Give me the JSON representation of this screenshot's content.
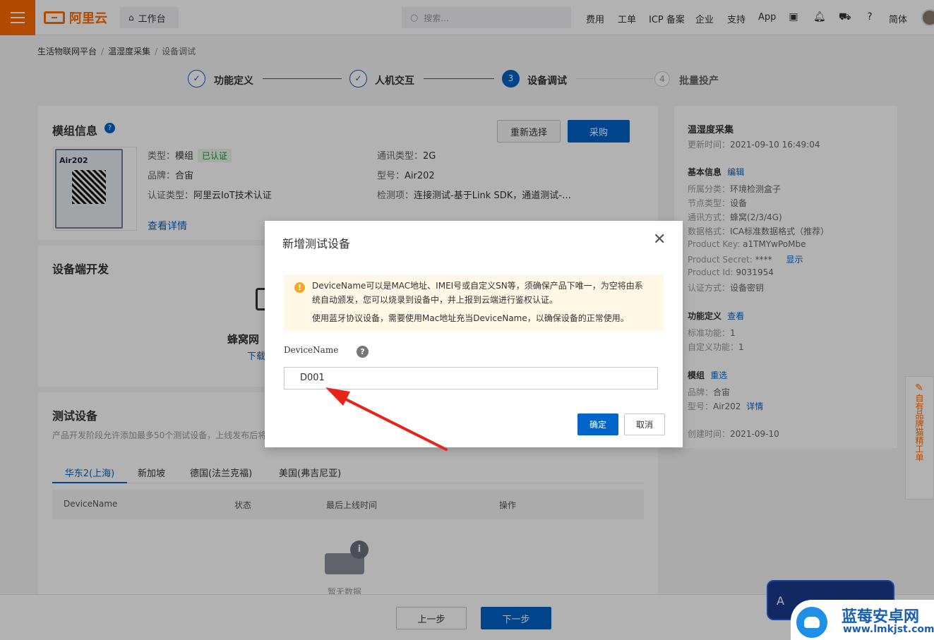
{
  "topbar": {
    "logo_text": "阿里云",
    "workbench_label": "工作台",
    "search_placeholder": "搜索...",
    "nav": [
      "费用",
      "工单",
      "ICP 备案",
      "企业",
      "支持",
      "App"
    ],
    "lang": "简体"
  },
  "breadcrumb": [
    "生活物联网平台",
    "温湿度采集",
    "设备调试"
  ],
  "steps": [
    {
      "num": "✓",
      "label": "功能定义"
    },
    {
      "num": "✓",
      "label": "人机交互"
    },
    {
      "num": "3",
      "label": "设备调试"
    },
    {
      "num": "4",
      "label": "批量投产"
    }
  ],
  "module": {
    "title": "模组信息",
    "reselect_label": "重新选择",
    "purchase_label": "采购",
    "chip_model_text": "Air202",
    "type_label": "类型：",
    "type_value": "模组",
    "certified_badge": "已认证",
    "brand_label": "品牌：",
    "brand_value": "合宙",
    "cert_label": "认证类型：",
    "cert_value": "阿里云IoT技术认证",
    "comm_label": "通讯类型：",
    "comm_value": "2G",
    "model_label": "型号：",
    "model_value": "Air202",
    "test_label": "检测项：",
    "test_value": "连接测试-基于Link SDK，通道测试-…",
    "details_link": "查看详情"
  },
  "device_dev": {
    "title": "设备端开发",
    "subtitle": "蜂窝网",
    "download_link": "下载"
  },
  "test_devices": {
    "title": "测试设备",
    "desc": "产品开发阶段允许添加最多50个测试设备，上线发布后将",
    "tabs": [
      "华东2(上海)",
      "新加坡",
      "德国(法兰克福)",
      "美国(弗吉尼亚)"
    ],
    "columns": [
      "DeviceName",
      "状态",
      "最后上线时间",
      "操作"
    ],
    "empty_text": "暂无数据"
  },
  "sidebar": {
    "product_name": "温湿度采集",
    "updated_label": "更新时间：",
    "updated_value": "2021-09-10 16:49:04",
    "basic_title": "基本信息",
    "edit_link": "编辑",
    "rows": [
      {
        "k": "所属分类：",
        "v": "环境检测盒子"
      },
      {
        "k": "节点类型：",
        "v": "设备"
      },
      {
        "k": "通讯方式：",
        "v": "蜂窝(2/3/4G)"
      },
      {
        "k": "数据格式：",
        "v": "ICA标准数据格式（推荐）"
      },
      {
        "k": "Product Key:",
        "v": "a1TMYwPoMbe"
      },
      {
        "k": "Product Secret:",
        "v": "****"
      },
      {
        "k": "Product Id:",
        "v": "9031954"
      },
      {
        "k": "认证方式：",
        "v": "设备密钥"
      }
    ],
    "show_link": "显示",
    "func_title": "功能定义",
    "view_link": "查看",
    "func_rows": [
      {
        "k": "标准功能：",
        "v": "1"
      },
      {
        "k": "自定义功能：",
        "v": "1"
      }
    ],
    "module_title": "模组",
    "reselect_link": "重选",
    "module_rows": [
      {
        "k": "品牌：",
        "v": "合宙"
      },
      {
        "k": "型号：",
        "v": "Air202"
      }
    ],
    "detail_link": "详情",
    "created_label": "创建时间：",
    "created_value": "2021-09-10"
  },
  "footer": {
    "prev_label": "上一步",
    "next_label": "下一步"
  },
  "side_tab": {
    "label": "自有品牌猫精工单"
  },
  "promo": {
    "letter": "A"
  },
  "dialog": {
    "title": "新增测试设备",
    "warn_line1": "DeviceName可以是MAC地址、IMEI号或自定义SN等，须确保产品下唯一，为空将由系",
    "warn_line2": "统自动颁发，您可以烧录到设备中，并上报到云端进行鉴权认证。",
    "warn_line3": "使用蓝牙协议设备，需要使用Mac地址充当DeviceName，以确保设备的正常使用。",
    "field_label": "DeviceName",
    "field_value": "D001",
    "confirm_label": "确定",
    "cancel_label": "取消"
  },
  "watermark": {
    "title": "蓝莓安卓网",
    "url": "www.lmkjst.com"
  },
  "colors": {
    "brand_orange": "#ff6a00",
    "primary_blue": "#0064c8",
    "arrow_red": "#e8231a",
    "warn_bg": "#fff8e6"
  }
}
